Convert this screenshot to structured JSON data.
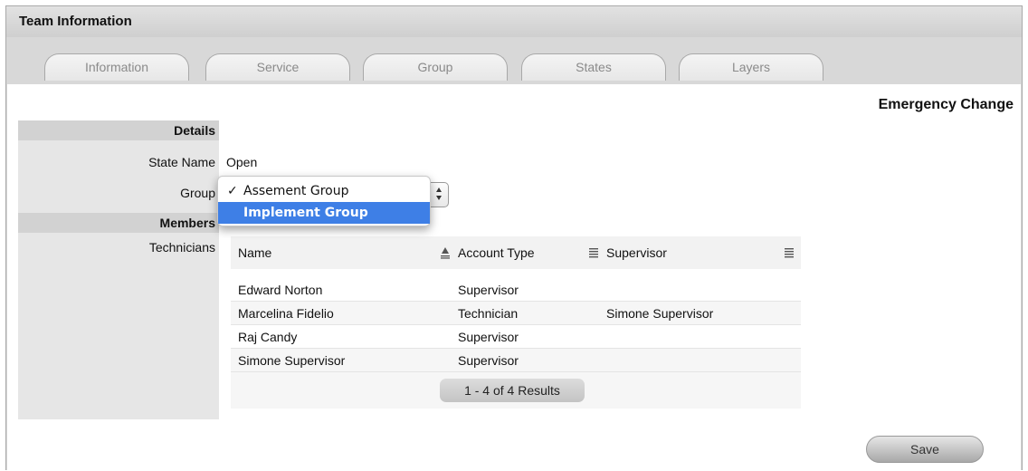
{
  "panel": {
    "title": "Team Information"
  },
  "tabs": [
    {
      "label": "Information"
    },
    {
      "label": "Service"
    },
    {
      "label": "Group"
    },
    {
      "label": "States"
    },
    {
      "label": "Layers"
    }
  ],
  "heading": "Emergency Change",
  "details": {
    "section_label": "Details",
    "state_name_label": "State Name",
    "state_name_value": "Open",
    "group_label": "Group",
    "group_options": [
      {
        "label": "Assement Group",
        "checked": true,
        "highlighted": false
      },
      {
        "label": "Implement Group",
        "checked": false,
        "highlighted": true
      }
    ],
    "members_label": "Members",
    "technicians_label": "Technicians"
  },
  "table": {
    "columns": [
      "Name",
      "Account Type",
      "Supervisor"
    ],
    "rows": [
      {
        "name": "Edward Norton",
        "account_type": "Supervisor",
        "supervisor": ""
      },
      {
        "name": "Marcelina Fidelio",
        "account_type": "Technician",
        "supervisor": "Simone Supervisor"
      },
      {
        "name": "Raj Candy",
        "account_type": "Supervisor",
        "supervisor": ""
      },
      {
        "name": "Simone Supervisor",
        "account_type": "Supervisor",
        "supervisor": ""
      }
    ],
    "pager": "1 - 4 of 4 Results"
  },
  "actions": {
    "save_label": "Save"
  },
  "icons": {
    "check": "checkmark-icon",
    "sort": "sort-icon",
    "select_arrows": "select-arrows-icon"
  },
  "colors": {
    "highlight": "#3e7fe6",
    "panel_bg": "#d8d8d8"
  }
}
